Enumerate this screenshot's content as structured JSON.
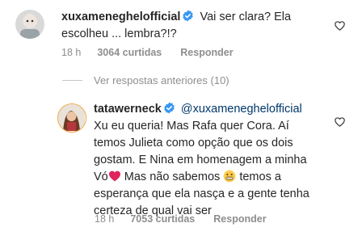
{
  "comments": [
    {
      "username": "xuxameneghelofficial",
      "text_line1": "Vai ser clara? Ela",
      "text_line2": "escolheu ... lembra?!?",
      "time": "18 h",
      "likes": "3064 curtidas",
      "reply_label": "Responder"
    },
    {
      "username": "tatawerneck",
      "mention": "@xuxameneghelofficial",
      "lines": [
        "Xu eu queria! Mas Rafa quer Cora. Aí",
        "temos Julieta como opção que os dois",
        "gostam. E Nina em homenagem a minha",
        "Vó",
        "Mas não sabemos",
        "temos a",
        "esperança que ela nasça e a gente tenha",
        "certeza de qual vai ser"
      ],
      "time": "18 h",
      "likes": "7053 curtidas",
      "reply_label": "Responder"
    }
  ],
  "view_replies": "Ver respostas anteriores (10)",
  "colors": {
    "verified": "#3897f0",
    "mention": "#00376b",
    "meta": "#8e8e8e",
    "heart_emoji": "#e0245e"
  },
  "icons": [
    "verified-badge-icon",
    "like-heart-icon",
    "red-heart-emoji",
    "grimace-face-emoji"
  ]
}
